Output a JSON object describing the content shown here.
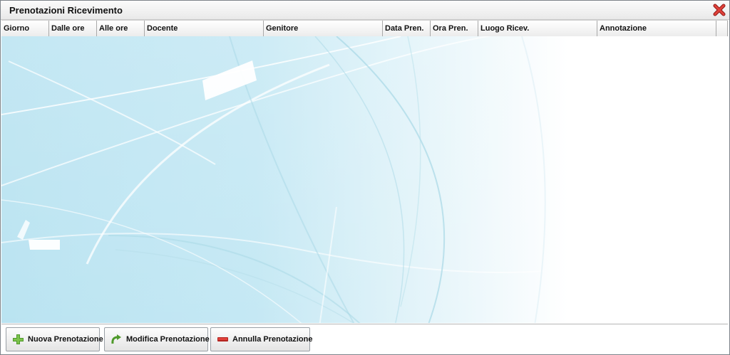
{
  "window": {
    "title": "Prenotazioni Ricevimento",
    "close_icon": "close-icon-red-x"
  },
  "table": {
    "columns": [
      "Giorno",
      "Dalle ore",
      "Alle ore",
      "Docente",
      "Genitore",
      "Data Pren.",
      "Ora Pren.",
      "Luogo Ricev.",
      "Annotazione"
    ],
    "rows": []
  },
  "footer": {
    "new_label": "Nuova Prenotazione",
    "edit_label": "Modifica Prenotazione",
    "cancel_label": "Annulla Prenotazione",
    "new_icon": "plus-icon",
    "edit_icon": "refresh-arrow-icon",
    "cancel_icon": "minus-icon"
  },
  "colors": {
    "background_accent": "#bfe6f2",
    "close_red": "#d9302b",
    "add_green": "#5aa532",
    "remove_red": "#d9302b"
  }
}
